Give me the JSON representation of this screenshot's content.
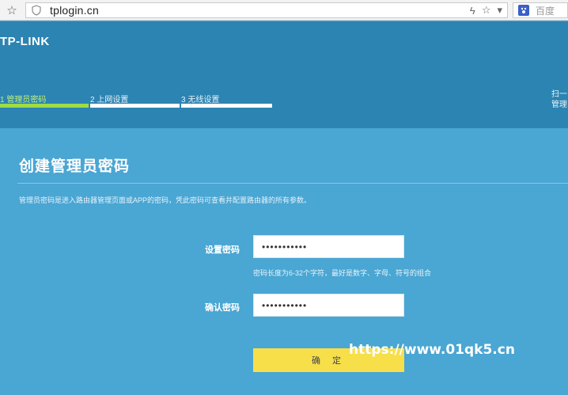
{
  "browser": {
    "url": "tplogin.cn",
    "search_placeholder": "百度",
    "icons": [
      "star-icon",
      "shield-icon",
      "bolt-icon",
      "star-icon",
      "chevron-down-icon",
      "baidu-paw-icon"
    ]
  },
  "header": {
    "logo": "TP-LINK",
    "steps": [
      {
        "label": "1 管理员密码",
        "active": true
      },
      {
        "label": "2 上网设置",
        "active": false
      },
      {
        "label": "3 无线设置",
        "active": false
      }
    ],
    "side_text_line1": "扫一",
    "side_text_line2": "管理"
  },
  "main": {
    "title": "创建管理员密码",
    "description": "管理员密码是进入路由器管理页面或APP的密码，凭此密码可查看并配置路由器的所有参数。",
    "password_label": "设置密码",
    "password_value": "•••••••••••",
    "password_hint": "密码长度为6-32个字符，最好是数字、字母、符号的组合",
    "confirm_label": "确认密码",
    "confirm_value": "•••••••••••",
    "submit_label": "确 定"
  },
  "watermark": "https://www.01qk5.cn",
  "colors": {
    "header_bg": "#2c84b2",
    "content_bg": "#4aa6d3",
    "active_step": "#9cdc45",
    "button": "#f7df4a"
  }
}
